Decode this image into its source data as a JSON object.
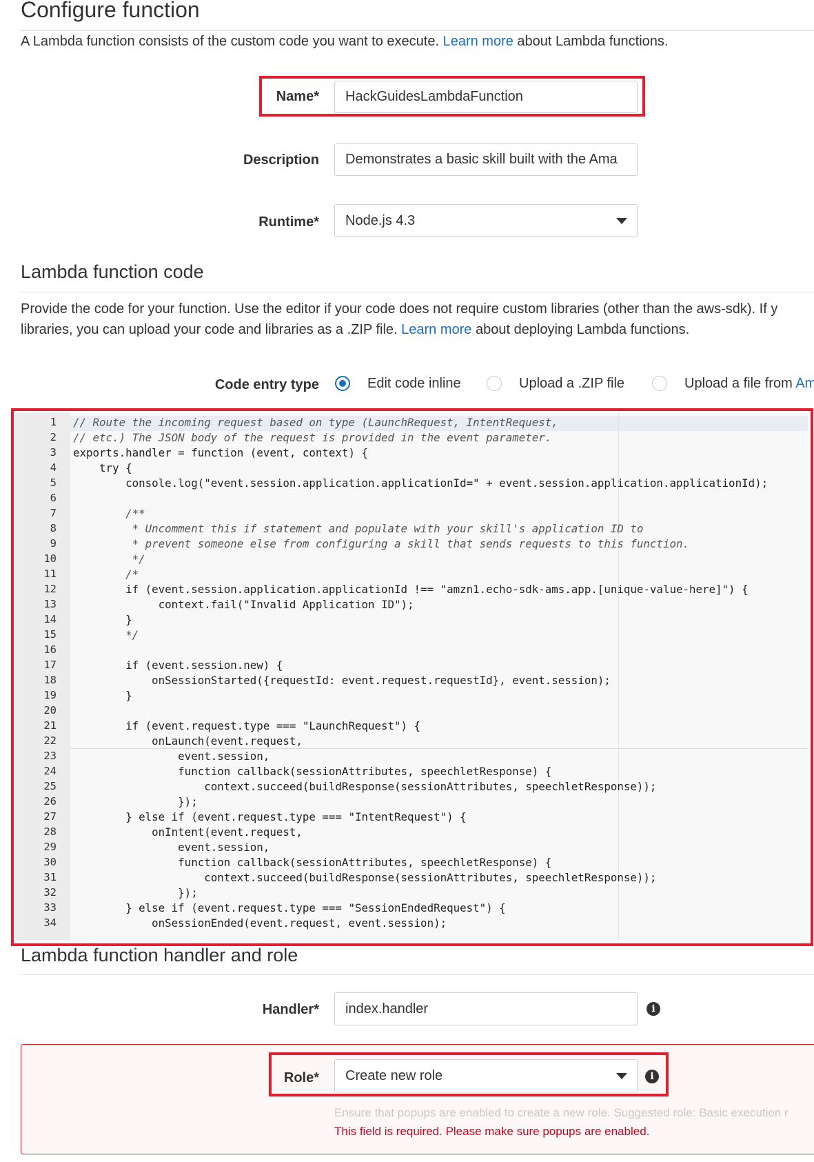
{
  "configure": {
    "title": "Configure function",
    "intro_pre": "A Lambda function consists of the custom code you want to execute. ",
    "intro_link": "Learn more",
    "intro_post": " about Lambda functions.",
    "name_label": "Name*",
    "name_value": "HackGuidesLambdaFunction",
    "description_label": "Description",
    "description_value": "Demonstrates a basic skill built with the Ama",
    "runtime_label": "Runtime*",
    "runtime_value": "Node.js 4.3"
  },
  "code_section": {
    "title": "Lambda function code",
    "para1": "Provide the code for your function. Use the editor if your code does not require custom libraries (other than the aws-sdk). If y",
    "para2_pre": "libraries, you can upload your code and libraries as a .ZIP file. ",
    "para2_link": "Learn more",
    "para2_post": " about deploying Lambda functions.",
    "entry_type_label": "Code entry type",
    "options": [
      {
        "label": "Edit code inline",
        "selected": true
      },
      {
        "label": "Upload a .ZIP file",
        "selected": false
      },
      {
        "label": "Upload a file from ",
        "link": "Am",
        "selected": false
      }
    ]
  },
  "editor": {
    "lines": [
      {
        "n": "1",
        "code": "// Route the incoming request based on type (LaunchRequest, IntentRequest,"
      },
      {
        "n": "2",
        "code": "// etc.) The JSON body of the request is provided in the event parameter."
      },
      {
        "n": "3",
        "code": "exports.handler = function (event, context) {"
      },
      {
        "n": "4",
        "code": "    try {"
      },
      {
        "n": "5",
        "code": "        console.log(\"event.session.application.applicationId=\" + event.session.application.applicationId);"
      },
      {
        "n": "6",
        "code": ""
      },
      {
        "n": "7",
        "code": "        /**"
      },
      {
        "n": "8",
        "code": "         * Uncomment this if statement and populate with your skill's application ID to"
      },
      {
        "n": "9",
        "code": "         * prevent someone else from configuring a skill that sends requests to this function."
      },
      {
        "n": "10",
        "code": "         */"
      },
      {
        "n": "11",
        "code": "        /*"
      },
      {
        "n": "12",
        "code": "        if (event.session.application.applicationId !== \"amzn1.echo-sdk-ams.app.[unique-value-here]\") {"
      },
      {
        "n": "13",
        "code": "             context.fail(\"Invalid Application ID\");"
      },
      {
        "n": "14",
        "code": "        }"
      },
      {
        "n": "15",
        "code": "        */"
      },
      {
        "n": "16",
        "code": ""
      },
      {
        "n": "17",
        "code": "        if (event.session.new) {"
      },
      {
        "n": "18",
        "code": "            onSessionStarted({requestId: event.request.requestId}, event.session);"
      },
      {
        "n": "19",
        "code": "        }"
      },
      {
        "n": "20",
        "code": ""
      },
      {
        "n": "21",
        "code": "        if (event.request.type === \"LaunchRequest\") {"
      },
      {
        "n": "22",
        "code": "            onLaunch(event.request,"
      },
      {
        "n": "23",
        "code": "                event.session,"
      },
      {
        "n": "24",
        "code": "                function callback(sessionAttributes, speechletResponse) {"
      },
      {
        "n": "25",
        "code": "                    context.succeed(buildResponse(sessionAttributes, speechletResponse));"
      },
      {
        "n": "26",
        "code": "                });"
      },
      {
        "n": "27",
        "code": "        } else if (event.request.type === \"IntentRequest\") {"
      },
      {
        "n": "28",
        "code": "            onIntent(event.request,"
      },
      {
        "n": "29",
        "code": "                event.session,"
      },
      {
        "n": "30",
        "code": "                function callback(sessionAttributes, speechletResponse) {"
      },
      {
        "n": "31",
        "code": "                    context.succeed(buildResponse(sessionAttributes, speechletResponse));"
      },
      {
        "n": "32",
        "code": "                });"
      },
      {
        "n": "33",
        "code": "        } else if (event.request.type === \"SessionEndedRequest\") {"
      },
      {
        "n": "34",
        "code": "            onSessionEnded(event.request, event.session);"
      }
    ]
  },
  "handler_section": {
    "title": "Lambda function handler and role",
    "handler_label": "Handler*",
    "handler_value": "index.handler",
    "role_label": "Role*",
    "role_value": "Create new role",
    "hint": "Ensure that popups are enabled to create a new role. Suggested role: Basic execution r",
    "error": "This field is required. Please make sure popups are enabled.",
    "info_glyph": "i"
  },
  "colors": {
    "link": "#1a6fc2",
    "highlight_red": "#e0202e",
    "error_text": "#d0021b",
    "error_bg": "#fdf7f7"
  },
  "icons": [
    "dropdown-caret-icon",
    "info-icon",
    "radio-icon"
  ]
}
